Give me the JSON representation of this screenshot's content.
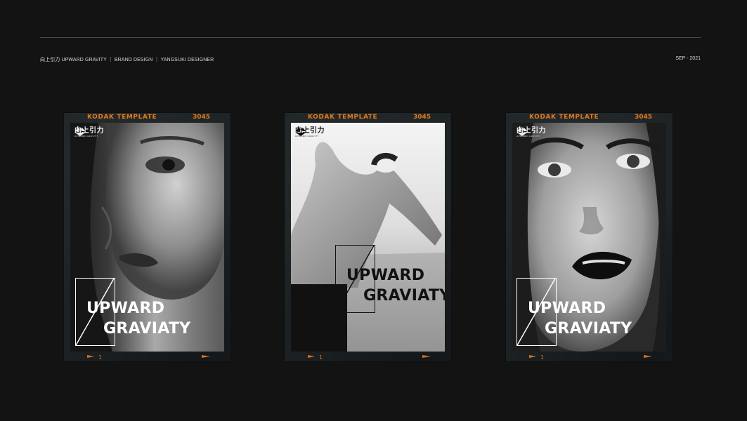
{
  "header": {
    "left_text": "向上引力 UPWARD GRAVITY ｜ BRAND DESIGN ｜ YANGSUKI DESIGNER",
    "right_text": "SEP - 2021"
  },
  "frame": {
    "brand": "KODAK TEMPLATE",
    "number": "3045",
    "footer_number": "1"
  },
  "poster": {
    "logo_cn": "向上引力",
    "logo_en": "UPWARD GRAVITY",
    "title_line1": "UPWARD",
    "title_line2": "GRAVIATY"
  },
  "colors": {
    "background": "#131313",
    "film_accent": "#e07a1a",
    "film_base": "#1d2225"
  }
}
